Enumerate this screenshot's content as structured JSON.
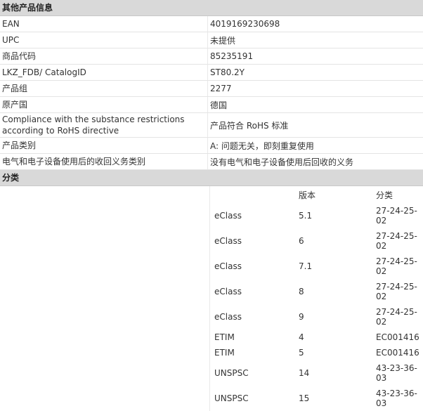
{
  "other_info": {
    "header": "其他产品信息",
    "rows": [
      {
        "label": "EAN",
        "value": "4019169230698"
      },
      {
        "label": "UPC",
        "value": "未提供"
      },
      {
        "label": "商品代码",
        "value": "85235191"
      },
      {
        "label": "LKZ_FDB/ CatalogID",
        "value": "ST80.2Y"
      },
      {
        "label": "产品组",
        "value": "2277"
      },
      {
        "label": "原产国",
        "value": "德国"
      },
      {
        "label": "Compliance with the substance restrictions according to RoHS directive",
        "value": "产品符合 RoHS 标准"
      },
      {
        "label": "产品类别",
        "value": "A: 问题无关，即刻重复使用"
      },
      {
        "label": "电气和电子设备使用后的收回义务类别",
        "value": "没有电气和电子设备使用后回收的义务"
      }
    ]
  },
  "classification": {
    "header": "分类",
    "col_version": "版本",
    "col_class": "分类",
    "rows": [
      {
        "system": "eClass",
        "version": "5.1",
        "code": "27-24-25-02"
      },
      {
        "system": "eClass",
        "version": "6",
        "code": "27-24-25-02"
      },
      {
        "system": "eClass",
        "version": "7.1",
        "code": "27-24-25-02"
      },
      {
        "system": "eClass",
        "version": "8",
        "code": "27-24-25-02"
      },
      {
        "system": "eClass",
        "version": "9",
        "code": "27-24-25-02"
      },
      {
        "system": "ETIM",
        "version": "4",
        "code": "EC001416"
      },
      {
        "system": "ETIM",
        "version": "5",
        "code": "EC001416"
      },
      {
        "system": "UNSPSC",
        "version": "14",
        "code": "43-23-36-03"
      },
      {
        "system": "UNSPSC",
        "version": "15",
        "code": "43-23-36-03"
      }
    ]
  }
}
